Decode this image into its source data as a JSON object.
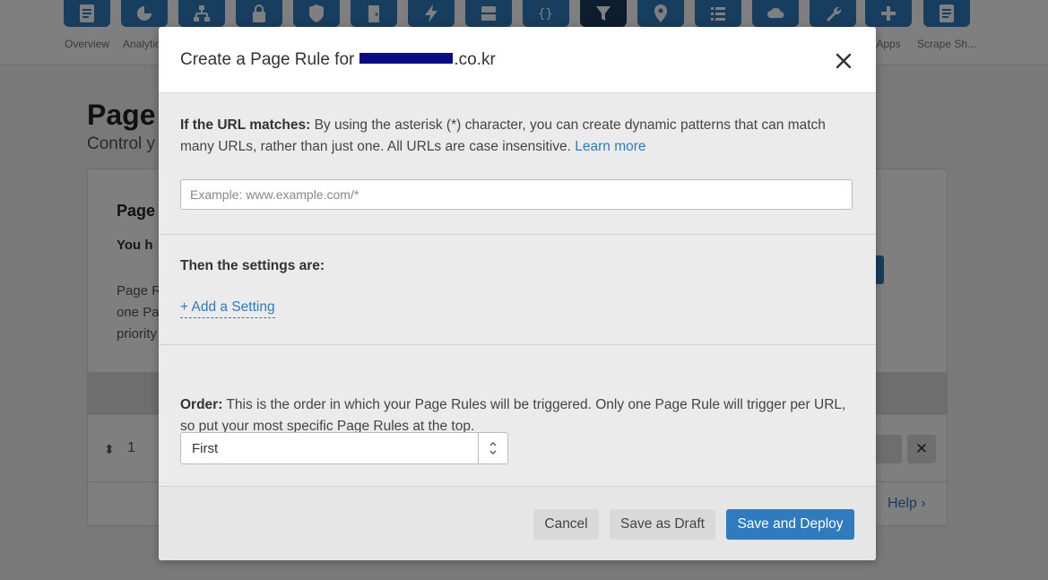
{
  "background": {
    "nav": [
      {
        "label": "Overview",
        "icon": "document-icon"
      },
      {
        "label": "Analytics",
        "icon": "pie-chart-icon"
      },
      {
        "label": "",
        "icon": "network-icon"
      },
      {
        "label": "",
        "icon": "lock-icon"
      },
      {
        "label": "",
        "icon": "shield-icon"
      },
      {
        "label": "",
        "icon": "door-icon"
      },
      {
        "label": "",
        "icon": "lightning-icon"
      },
      {
        "label": "",
        "icon": "server-icon"
      },
      {
        "label": "",
        "icon": "code-icon"
      },
      {
        "label": "",
        "icon": "filter-icon"
      },
      {
        "label": "",
        "icon": "map-pin-icon"
      },
      {
        "label": "",
        "icon": "list-icon"
      },
      {
        "label": "",
        "icon": "cloud-icon"
      },
      {
        "label": "",
        "icon": "wrench-icon"
      },
      {
        "label": "Apps",
        "icon": "plus-icon"
      },
      {
        "label": "Scrape Sh...",
        "icon": "document-icon"
      }
    ],
    "page_title": "Page",
    "page_subtitle": "Control y",
    "card_title": "Page",
    "card_you": "You h",
    "card_text": "Page R one Pa priority",
    "row_number": "1",
    "help_link": "Help ›"
  },
  "modal": {
    "title_prefix": "Create a Page Rule for",
    "title_suffix": ".co.kr",
    "url_section": {
      "label": "If the URL matches:",
      "description": "By using the asterisk (*) character, you can create dynamic patterns that can match many URLs, rather than just one. All URLs are case insensitive.",
      "learn_more": "Learn more",
      "input_value": "",
      "input_placeholder": "Example: www.example.com/*"
    },
    "settings_section": {
      "heading": "Then the settings are:",
      "add_setting": "+ Add a Setting"
    },
    "order_section": {
      "label": "Order:",
      "description": "This is the order in which your Page Rules will be triggered. Only one Page Rule will trigger per URL, so put your most specific Page Rules at the top.",
      "selected": "First"
    },
    "buttons": {
      "cancel": "Cancel",
      "save_draft": "Save as Draft",
      "save_deploy": "Save and Deploy"
    }
  },
  "colors": {
    "accent": "#2f7bbf",
    "overlay": "rgba(0,0,0,0.5)",
    "modal_bg": "#ebebeb"
  }
}
